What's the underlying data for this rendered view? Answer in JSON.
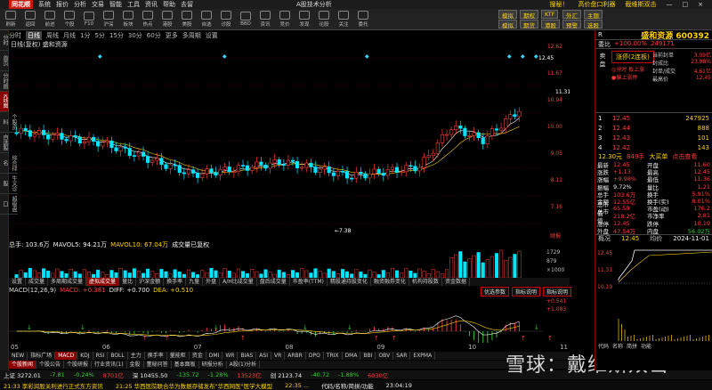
{
  "menubar": {
    "items": [
      "系统",
      "报价",
      "分析",
      "交易",
      "智能",
      "工具",
      "资讯",
      "帮助",
      "去留"
    ],
    "logo": "同花顺",
    "title": "A股技术分析",
    "right": [
      "搜秘！",
      "高价盘口利器",
      "截维斯双击",
      "—",
      "□",
      "×"
    ]
  },
  "toolbar": {
    "items": [
      "刷新",
      "返回",
      "前进",
      "个股",
      "F10",
      "沪深",
      "板块",
      "热点",
      "港股",
      "美股",
      "自选",
      "诊股",
      "BBD",
      "资讯",
      "竞价",
      "发现",
      "论股",
      "关注",
      "委托"
    ],
    "right_buttons": [
      "模拟",
      "期权",
      "KTF",
      "外汇",
      "主题",
      "模拟",
      "期货",
      "港股",
      "预警",
      "选股"
    ]
  },
  "left_tabs": [
    "分时",
    "首页",
    "分时图",
    "K线图",
    "个股资料",
    "自选股",
    "综合排名",
    "牛叉诊股",
    "超级盘口"
  ],
  "periods": [
    "分时",
    "日线",
    "周线",
    "月线",
    "1分",
    "5分",
    "15分",
    "30分",
    "60分",
    "更多",
    "多周期",
    "设置"
  ],
  "chart": {
    "title": "日线(复权)",
    "name": "盛和资源",
    "price_labels": [
      "12.62",
      "11.67",
      "10.94",
      "10.00",
      "9.05",
      "8.11",
      "7.16"
    ],
    "high_label": "12.45",
    "low_label": "7.38",
    "last_label": "11.31",
    "flag": "财报"
  },
  "volume": {
    "label1": "总手: 103.6万",
    "label2": "MAVOL5: 94.21万",
    "label3": "MAVOL10: 67.04万",
    "label4": "成交量已复权",
    "axis": [
      "1729",
      "879",
      "×1000"
    ]
  },
  "tabs1": [
    "设置",
    "成交量",
    "多周期成交量",
    "虚拟成交量",
    "量比",
    "沪深金额",
    "换手率",
    "九量",
    "外盘",
    "A/H比成交量",
    "盘后成交量",
    "市盈率(TTM)",
    "精股通持股变化",
    "融资融券变化",
    "机构持股数",
    "资金数据"
  ],
  "macd": {
    "label": "MACD(12,26,9)",
    "macd_val": "MACD: +0.381",
    "diff": "DIFF: +0.700",
    "dea": "DEA: +0.510",
    "axis": [
      "+0.541",
      "+1.083",
      "+0.541"
    ],
    "btns": [
      "优选参数",
      "指标说明",
      "指标说明"
    ]
  },
  "dates": [
    "05",
    "06",
    "07",
    "08",
    "09",
    "10",
    "11"
  ],
  "tabs2": [
    "NEW",
    "指标广场",
    "MACD",
    "KDJ",
    "RSI",
    "BOLL",
    "主力",
    "换手率",
    "量能柜",
    "资金",
    "DMI",
    "WR",
    "BIAS",
    "ASI",
    "VR",
    "ARBR",
    "DPO",
    "TRIX",
    "DMA",
    "BBI",
    "OBV",
    "SAR",
    "EXPMA"
  ],
  "tabs3": [
    "个股新闻",
    "个股公告",
    "个股研报",
    "行业资讯(1)",
    "金股",
    "董秘问答",
    "基本面板",
    "研报分析",
    "A股(1)分析"
  ],
  "status": [
    "上证 3272.01",
    "-7.81",
    "-0.24%",
    "8701亿",
    "深 10455.50",
    "-135.72",
    "-1.28%",
    "13523亿",
    "创 2123.74",
    "-40.72",
    "-1.88%",
    "6030亿"
  ],
  "news": [
    "21:33 李彩润股关利进行正式东方资讯",
    "21:25 华西医院联合华为数据存储发布\"华西网医\"医学大模型",
    "22:35 ...",
    "代码/名称/简拼/功能",
    "23:04:19"
  ],
  "watermark": "雪球：戴维斯双击",
  "quote": {
    "name": "盛和资源",
    "code": "600392",
    "ratio_label": "委比",
    "ratio": "+100.00%",
    "diff": "249171",
    "limit_tag": "涨停(2连板)",
    "info_rows": [
      {
        "k": "当前封单",
        "v": "3.09亿"
      },
      {
        "k": "封成比",
        "v": "23.98%"
      },
      {
        "k": "封单/成交",
        "v": "4.61亿"
      },
      {
        "k": "最高价",
        "v": "12.45"
      }
    ],
    "bids": [
      {
        "l": "1",
        "p": "12.45",
        "v": "247925"
      },
      {
        "l": "2",
        "p": "12.44",
        "v": "888"
      },
      {
        "l": "3",
        "p": "12.43",
        "v": "101"
      },
      {
        "l": "4",
        "p": "12.42",
        "v": "143"
      }
    ],
    "summary": {
      "mcap": "12.30元",
      "pct": "849手",
      "type": "大买单",
      "link": "点击查看"
    },
    "rows": [
      {
        "k1": "最新",
        "v1": "12.45",
        "k2": "开盘",
        "v2": "11.60"
      },
      {
        "k1": "涨跌",
        "v1": "+1.13",
        "k2": "最高",
        "v2": "12.45"
      },
      {
        "k1": "涨幅",
        "v1": "+9.98%",
        "k2": "最低",
        "v2": "11.36"
      },
      {
        "k1": "振幅",
        "v1": "9.72%",
        "k2": "量比",
        "v2": "1.21"
      },
      {
        "k1": "总手",
        "v1": "103.6万",
        "k2": "换手",
        "v2": "5.91%"
      },
      {
        "k1": "金额",
        "v1": "12.55亿",
        "k2": "换手(实)",
        "v2": "8.01%"
      },
      {
        "k1": "总市值",
        "v1": "65.59",
        "k2": "市盈(动)",
        "v2": "176.2"
      },
      {
        "k1": "总市值",
        "v1": "218.2亿",
        "k2": "市净率",
        "v2": "2.81"
      },
      {
        "k1": "涨停",
        "v1": "12.45",
        "k2": "跌停",
        "v2": "10.19"
      },
      {
        "k1": "外盘",
        "v1": "47.54万",
        "k2": "内盘",
        "v2": "56.02万"
      }
    ],
    "mini_head": [
      "概况",
      "12:45",
      "均价",
      "2024-11-01"
    ],
    "mini_axis": [
      "12.45",
      "11.31",
      "10.19"
    ],
    "rtabs": [
      "代码",
      "名称",
      "简拼",
      "功能"
    ]
  },
  "colors": {
    "up": "#ff3b3b",
    "down": "#00e5ff",
    "ma5": "#ffffff",
    "ma10": "#ffd200",
    "bg": "#000000"
  }
}
